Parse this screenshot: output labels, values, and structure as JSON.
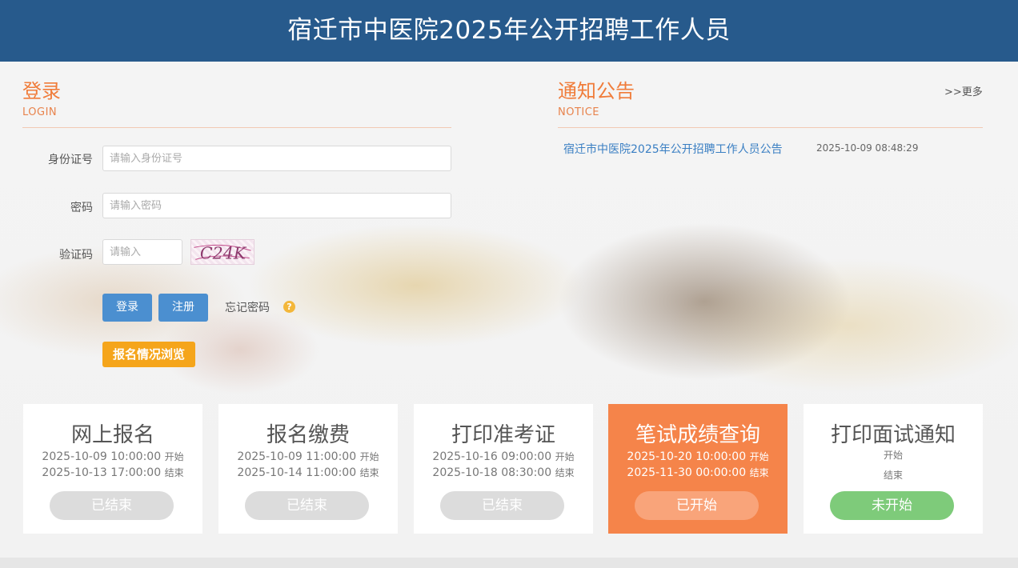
{
  "header": {
    "title": "宿迁市中医院2025年公开招聘工作人员"
  },
  "login": {
    "title": "登录",
    "subtitle": "LOGIN",
    "id_label": "身份证号",
    "id_placeholder": "请输入身份证号",
    "password_label": "密码",
    "password_placeholder": "请输入密码",
    "captcha_label": "验证码",
    "captcha_placeholder": "请输入",
    "captcha_text": "C24K",
    "login_button": "登录",
    "register_button": "注册",
    "forgot_password": "忘记密码",
    "help_icon": "question-icon",
    "browse_button": "报名情况浏览"
  },
  "notice": {
    "title": "通知公告",
    "subtitle": "NOTICE",
    "more": ">>更多",
    "items": [
      {
        "title": "宿迁市中医院2025年公开招聘工作人员公告",
        "time": "2025-10-09 08:48:29"
      }
    ]
  },
  "stages": [
    {
      "title": "网上报名",
      "start": "2025-10-09 10:00:00",
      "start_suffix": "开始",
      "end": "2025-10-13 17:00:00",
      "end_suffix": "结束",
      "status": "已结束"
    },
    {
      "title": "报名缴费",
      "start": "2025-10-09 11:00:00",
      "start_suffix": "开始",
      "end": "2025-10-14 11:00:00",
      "end_suffix": "结束",
      "status": "已结束"
    },
    {
      "title": "打印准考证",
      "start": "2025-10-16 09:00:00",
      "start_suffix": "开始",
      "end": "2025-10-18 08:30:00",
      "end_suffix": "结束",
      "status": "已结束"
    },
    {
      "title": "笔试成绩查询",
      "start": "2025-10-20 10:00:00",
      "start_suffix": "开始",
      "end": "2025-11-30 00:00:00",
      "end_suffix": "结束",
      "status": "已开始"
    },
    {
      "title": "打印面试通知",
      "start": "",
      "start_suffix": "开始",
      "end": "",
      "end_suffix": "结束",
      "status": "未开始"
    }
  ],
  "colors": {
    "header_bg": "#275a8c",
    "accent_orange": "#f07c3a",
    "active_card": "#f5844a",
    "button_blue": "#4b8fd0",
    "button_yellow": "#f5a51b",
    "not_started_green": "#7ecb7a",
    "ended_gray": "#dcdcdc"
  }
}
